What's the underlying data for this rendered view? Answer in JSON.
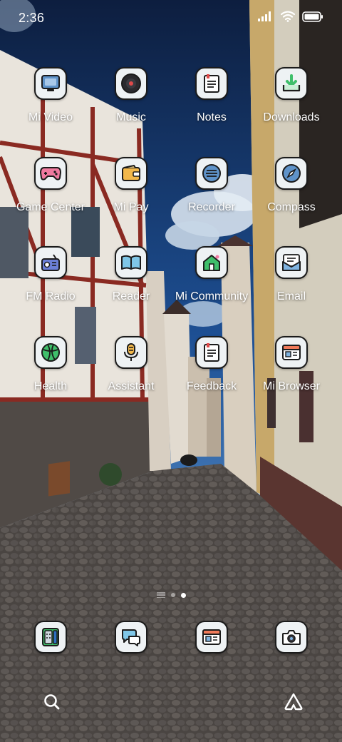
{
  "status_bar": {
    "time": "2:36",
    "icons": [
      "signal-icon",
      "wifi-icon",
      "battery-icon"
    ]
  },
  "apps": [
    {
      "label": "Mi Video",
      "icon": "tv-icon"
    },
    {
      "label": "Music",
      "icon": "music-disc-icon"
    },
    {
      "label": "Notes",
      "icon": "notes-icon"
    },
    {
      "label": "Downloads",
      "icon": "download-tray-icon"
    },
    {
      "label": "Game Center",
      "icon": "gamepad-icon"
    },
    {
      "label": "Mi Pay",
      "icon": "wallet-icon"
    },
    {
      "label": "Recorder",
      "icon": "recorder-icon"
    },
    {
      "label": "Compass",
      "icon": "compass-icon"
    },
    {
      "label": "FM Radio",
      "icon": "radio-icon"
    },
    {
      "label": "Reader",
      "icon": "book-icon"
    },
    {
      "label": "Mi Community",
      "icon": "house-icon"
    },
    {
      "label": "Email",
      "icon": "email-icon"
    },
    {
      "label": "Health",
      "icon": "ball-icon"
    },
    {
      "label": "Assistant",
      "icon": "microphone-icon"
    },
    {
      "label": "Feedback",
      "icon": "feedback-icon"
    },
    {
      "label": "Mi Browser",
      "icon": "browser-icon"
    }
  ],
  "dock": [
    {
      "icon": "calculator-icon"
    },
    {
      "icon": "chat-bubbles-icon"
    },
    {
      "icon": "browser-icon"
    },
    {
      "icon": "camera-icon"
    }
  ],
  "page_indicator": {
    "pages": 2,
    "active": 2
  },
  "search": {
    "icons": [
      "search-icon",
      "assistant-icon"
    ]
  },
  "colors": {
    "icon_bg": "#eef2f4",
    "icon_border": "#1b1b1b",
    "accent_green": "#3fbf6b",
    "accent_pink": "#f07aa0"
  }
}
